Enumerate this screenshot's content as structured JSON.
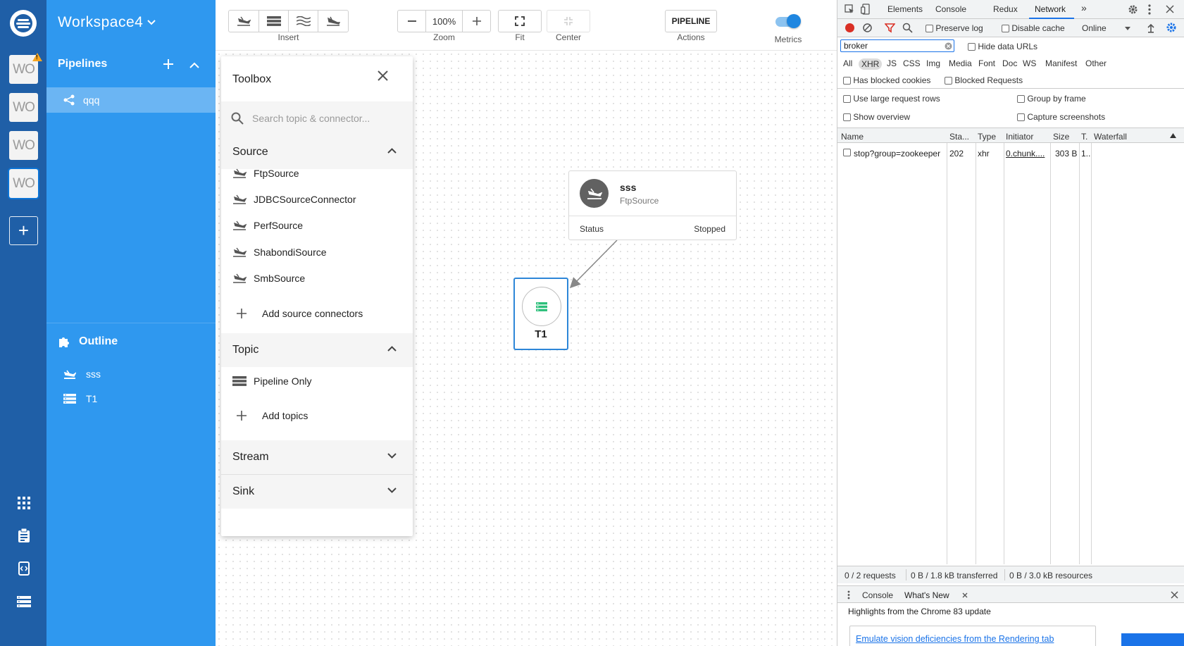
{
  "colors": {
    "rail_bg": "#1f5fa7",
    "sidebar_bg": "#2f98ef",
    "selected_pipe_bg": "#6bb5f3",
    "topic_border": "#2d86d8",
    "devtools_accent": "#1a73e8"
  },
  "rail": {
    "workspace_tiles": [
      "WO",
      "WO",
      "WO",
      "WO"
    ],
    "warning_glyph": "!",
    "add_glyph": "+",
    "bottom_icons": [
      "apps-icon",
      "clipboard-icon",
      "developer-tools-icon",
      "nodes-list-icon"
    ]
  },
  "sidebar": {
    "workspace_title": "Workspace4",
    "pipelines_header": "Pipelines",
    "pipelines": [
      {
        "name": "qqq"
      }
    ],
    "outline_header": "Outline",
    "outline_items": [
      {
        "name": "sss",
        "icon": "source-icon"
      },
      {
        "name": "T1",
        "icon": "topic-icon"
      }
    ]
  },
  "toolbar": {
    "insert_label": "Insert",
    "zoom_value": "100%",
    "zoom_label": "Zoom",
    "fit_label": "Fit",
    "center_label": "Center",
    "pipeline_button": "PIPELINE",
    "actions_label": "Actions",
    "metrics_label": "Metrics",
    "metrics_enabled": true
  },
  "toolbox": {
    "title": "Toolbox",
    "search_placeholder": "Search topic & connector...",
    "sections": {
      "source": {
        "title": "Source",
        "expanded": true,
        "items": [
          "FtpSource",
          "JDBCSourceConnector",
          "PerfSource",
          "ShabondiSource",
          "SmbSource"
        ],
        "add_label": "Add source connectors"
      },
      "topic": {
        "title": "Topic",
        "expanded": true,
        "items": [
          "Pipeline Only"
        ],
        "add_label": "Add topics"
      },
      "stream": {
        "title": "Stream",
        "expanded": false
      },
      "sink": {
        "title": "Sink",
        "expanded": false
      }
    }
  },
  "graph": {
    "connector": {
      "name": "sss",
      "kind": "FtpSource",
      "status_label": "Status",
      "status_value": "Stopped"
    },
    "topic": {
      "name": "T1"
    }
  },
  "devtools": {
    "tabs": [
      "Elements",
      "Console",
      "Redux",
      "Network"
    ],
    "active_tab": "Network",
    "more_tabs": "»",
    "preserve_log": "Preserve log",
    "disable_cache": "Disable cache",
    "throttle": "Online",
    "filter_value": "broker",
    "hide_data_urls": "Hide data URLs",
    "type_filters": [
      "All",
      "XHR",
      "JS",
      "CSS",
      "Img",
      "Media",
      "Font",
      "Doc",
      "WS",
      "Manifest",
      "Other"
    ],
    "active_type": "XHR",
    "has_blocked_cookies": "Has blocked cookies",
    "blocked_requests": "Blocked Requests",
    "large_rows": "Use large request rows",
    "group_by_frame": "Group by frame",
    "show_overview": "Show overview",
    "capture_screenshots": "Capture screenshots",
    "columns": [
      "Name",
      "Sta...",
      "Type",
      "Initiator",
      "Size",
      "T.",
      "Waterfall"
    ],
    "requests": [
      {
        "name": "stop?group=zookeeper",
        "status": "202",
        "type": "xhr",
        "initiator": "0.chunk....",
        "size": "303 B",
        "time": "1.."
      }
    ],
    "status_requests": "0 / 2 requests",
    "status_transferred": "0 B / 1.8 kB transferred",
    "status_resources": "0 B / 3.0 kB resources",
    "drawer_tabs": [
      "Console",
      "What's New"
    ],
    "drawer_highlight": "Highlights from the Chrome 83 update",
    "drawer_card_link": "Emulate vision deficiencies from the Rendering tab"
  }
}
